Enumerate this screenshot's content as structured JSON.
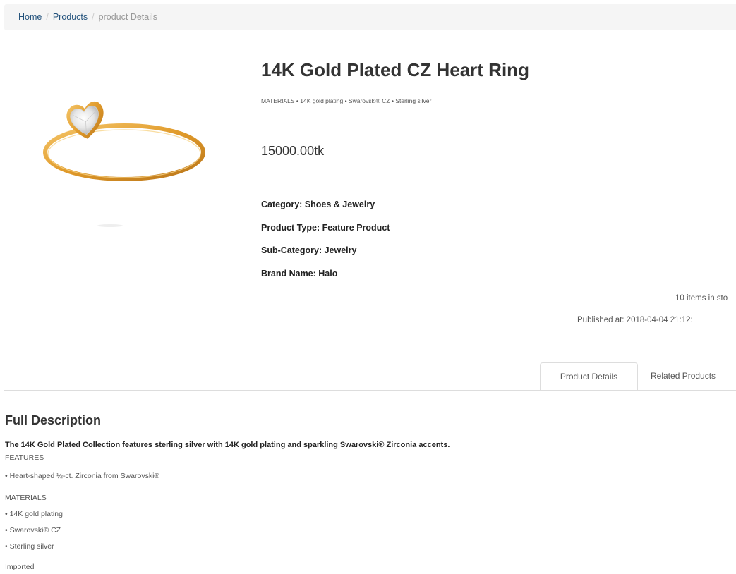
{
  "breadcrumb": {
    "home": "Home",
    "products": "Products",
    "current": "product Details",
    "separator": "/"
  },
  "product": {
    "title": "14K Gold Plated CZ Heart Ring",
    "materials_line": "MATERIALS • 14K gold plating • Swarovski® CZ • Sterling silver",
    "price": "15000.00tk",
    "category": "Category: Shoes & Jewelry",
    "product_type": "Product Type: Feature Product",
    "sub_category": "Sub-Category: Jewelry",
    "brand": "Brand Name: Halo",
    "stock": "10 items in sto",
    "published": "Published at: 2018-04-04 21:12:",
    "image_icon": "gold-heart-ring-image"
  },
  "tabs": {
    "details": "Product Details",
    "related": "Related Products"
  },
  "description": {
    "title": "Full Description",
    "lead": "The 14K Gold Plated Collection features sterling silver with 14K gold plating and sparkling Swarovski® Zirconia accents.",
    "features_heading": "FEATURES",
    "feature_1": "• Heart-shaped ½-ct. Zirconia from Swarovski®",
    "materials_heading": "MATERIALS",
    "material_1": "• 14K gold plating",
    "material_2": "• Swarovski® CZ",
    "material_3": "• Sterling silver",
    "origin": "Imported"
  },
  "colors": {
    "link": "#337ab7",
    "gold": "#e3a23a",
    "breadcrumb_bg": "#f5f5f5"
  }
}
